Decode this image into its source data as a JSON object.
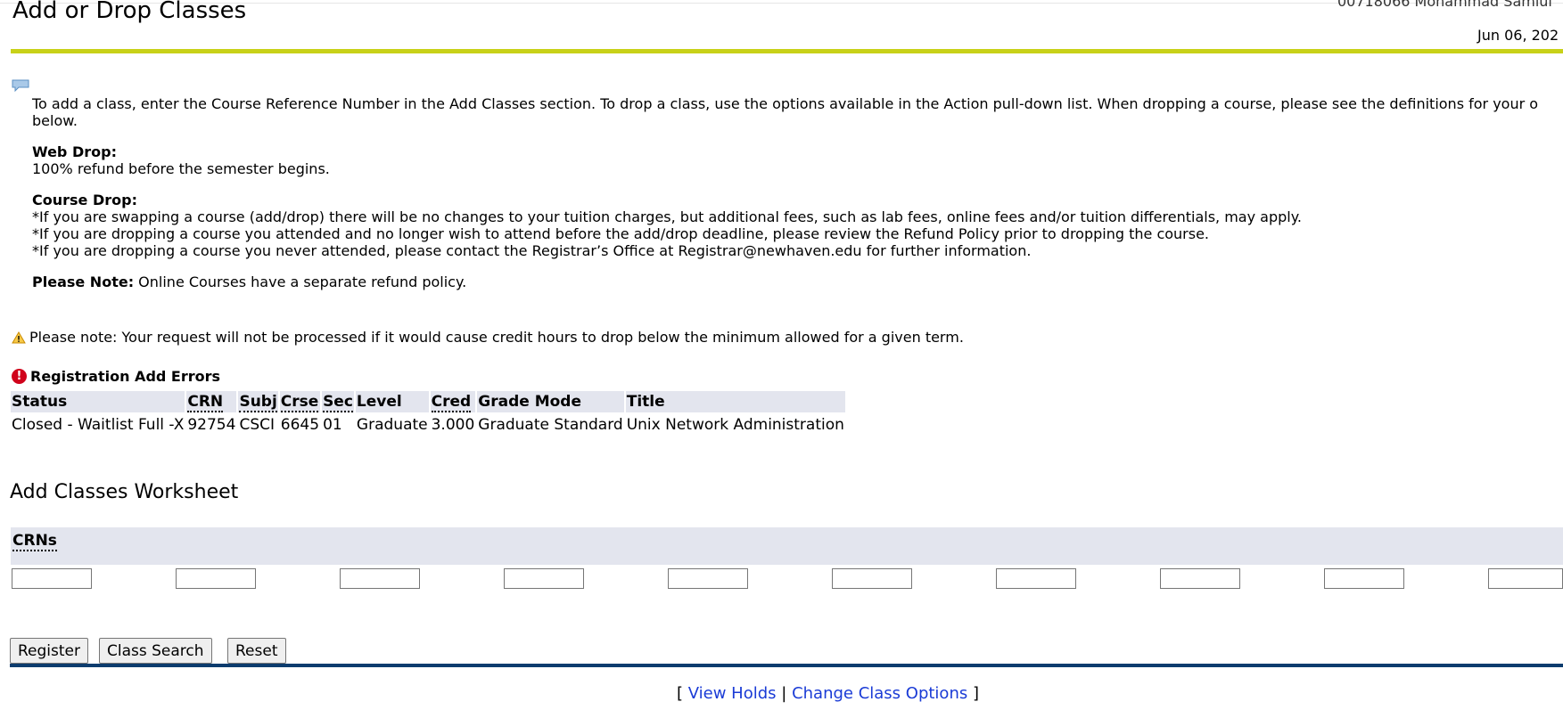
{
  "header": {
    "title": "Add or Drop Classes",
    "user_id": "00718066 Mohammad Samiul",
    "date": "Jun 06, 202"
  },
  "info": {
    "intro": "To add a class, enter the Course Reference Number in the Add Classes section. To drop a class, use the options available in the Action pull-down list. When dropping a course, please see the definitions for your o\nbelow.",
    "web_drop_label": "Web Drop:",
    "web_drop_text": "100% refund before the semester begins.",
    "course_drop_label": "Course Drop:",
    "course_drop_lines": [
      "*If you are swapping a course (add/drop) there will be no changes to your tuition charges, but additional fees, such as lab fees, online fees and/or tuition differentials, may apply.",
      "*If you are dropping a course you attended and no longer wish to attend before the add/drop deadline, please review the Refund Policy prior to dropping the course.",
      "*If you are dropping a course you never attended, please contact the Registrar’s Office at Registrar@newhaven.edu for further information."
    ],
    "please_note_label": "Please Note:",
    "please_note_text": " Online Courses have a separate refund policy."
  },
  "warning": "Please note: Your request will not be processed if it would cause credit hours to drop below the minimum allowed for a given term.",
  "errors": {
    "title": "Registration Add Errors",
    "columns": [
      "Status",
      "CRN",
      "Subj",
      "Crse",
      "Sec",
      "Level",
      "Cred",
      "Grade Mode",
      "Title"
    ],
    "rows": [
      [
        "Closed - Waitlist Full -X",
        "92754",
        "CSCI",
        "6645",
        "01",
        "Graduate",
        "3.000",
        "Graduate Standard",
        "Unix Network Administration"
      ]
    ]
  },
  "worksheet": {
    "title": "Add Classes Worksheet",
    "crns_label": "CRNs",
    "crn_values": [
      "",
      "",
      "",
      "",
      "",
      "",
      "",
      "",
      "",
      ""
    ]
  },
  "buttons": {
    "register": "Register",
    "class_search": "Class Search",
    "reset": "Reset"
  },
  "links": {
    "open": "[ ",
    "view_holds": "View Holds",
    "separator": " | ",
    "change_class_options": "Change Class Options",
    "close": " ]"
  },
  "colors": {
    "accent_rule": "#c8d118",
    "footer_rule": "#0c3c6e",
    "header_bg": "#e3e5ee",
    "link": "#1a3bd6",
    "error": "#d0021b"
  }
}
